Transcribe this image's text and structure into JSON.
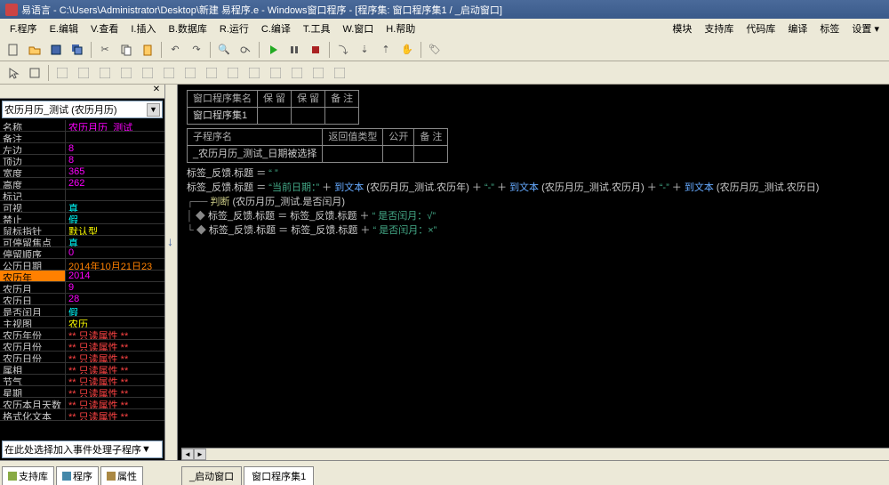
{
  "title": "易语言 - C:\\Users\\Administrator\\Desktop\\新建 易程序.e - Windows窗口程序 - [程序集: 窗口程序集1 / _启动窗口]",
  "menu": {
    "m1": "F.程序",
    "m2": "E.编辑",
    "m3": "V.查看",
    "m4": "I.插入",
    "m5": "B.数据库",
    "m6": "R.运行",
    "m7": "C.编译",
    "m8": "T.工具",
    "m9": "W.窗口",
    "m10": "H.帮助",
    "r1": "模块",
    "r2": "支持库",
    "r3": "代码库",
    "r4": "编译",
    "r5": "标签",
    "r6": "设置 ▾"
  },
  "combo_top": "农历月历_测试 (农历月历)",
  "props": [
    {
      "n": "名称",
      "v": "农历月历_测试",
      "c": "v-magenta"
    },
    {
      "n": "备注",
      "v": "",
      "c": ""
    },
    {
      "n": "左边",
      "v": "8",
      "c": "v-magenta"
    },
    {
      "n": "顶边",
      "v": "8",
      "c": "v-magenta"
    },
    {
      "n": "宽度",
      "v": "365",
      "c": "v-magenta"
    },
    {
      "n": "高度",
      "v": "262",
      "c": "v-magenta"
    },
    {
      "n": "标记",
      "v": "",
      "c": ""
    },
    {
      "n": "可视",
      "v": "真",
      "c": "v-cyan"
    },
    {
      "n": "禁止",
      "v": "假",
      "c": "v-cyan"
    },
    {
      "n": "鼠标指针",
      "v": "默认型",
      "c": "v-yellow"
    },
    {
      "n": "可停留焦点",
      "v": "真",
      "c": "v-cyan"
    },
    {
      "n": "  停留顺序",
      "v": "0",
      "c": "v-magenta"
    },
    {
      "n": "公历日期",
      "v": "2014年10月21日23",
      "c": "v-orange"
    },
    {
      "n": "农历年",
      "v": "2014",
      "c": "v-magenta",
      "sel": true
    },
    {
      "n": "农历月",
      "v": "9",
      "c": "v-magenta"
    },
    {
      "n": "农历日",
      "v": "28",
      "c": "v-magenta"
    },
    {
      "n": "是否闰月",
      "v": "假",
      "c": "v-cyan"
    },
    {
      "n": "主视图",
      "v": "农历",
      "c": "v-yellow"
    },
    {
      "n": "农历年份",
      "v": "** 只读属性 **",
      "c": "v-red"
    },
    {
      "n": "农历月份",
      "v": "** 只读属性 **",
      "c": "v-red"
    },
    {
      "n": "农历日份",
      "v": "** 只读属性 **",
      "c": "v-red"
    },
    {
      "n": "属相",
      "v": "** 只读属性 **",
      "c": "v-red"
    },
    {
      "n": "节气",
      "v": "** 只读属性 **",
      "c": "v-red"
    },
    {
      "n": "星期",
      "v": "** 只读属性 **",
      "c": "v-red"
    },
    {
      "n": "农历本月天数",
      "v": "** 只读属性 **",
      "c": "v-red"
    },
    {
      "n": "格式化文本",
      "v": "** 只读属性 **",
      "c": "v-red"
    }
  ],
  "event_combo": "在此处选择加入事件处理子程序",
  "bottom_tabs": {
    "t1": "支持库",
    "t2": "程序",
    "t3": "属性"
  },
  "editor_tabs": {
    "e1": "_启动窗口",
    "e2": "窗口程序集1"
  },
  "grid1": {
    "h1": "窗口程序集名",
    "h2": "保 留",
    "h3": "保 留",
    "h4": "备 注",
    "r1": "窗口程序集1"
  },
  "grid2": {
    "h1": "子程序名",
    "h2": "返回值类型",
    "h3": "公开",
    "h4": "备 注",
    "r1": "_农历月历_测试_日期被选择"
  },
  "code": {
    "l1a": "标签_反馈.标题 ＝ ",
    "l1b": "“ ”",
    "l2a": "标签_反馈.标题 ＝ ",
    "l2b": "“当前日期：”",
    "l2c": " ＋ ",
    "l2d": "到文本",
    "l2e": " (农历月历_测试.农历年) ",
    "l2f": "＋ ",
    "l2g": "“-”",
    "l2h": " ＋ ",
    "l2i": "到文本",
    "l2j": " (农历月历_测试.农历月) ",
    "l2k": "＋ ",
    "l2l": "“-”",
    "l2m": " ＋ ",
    "l2n": "到文本",
    "l2o": " (农历月历_测试.农历日)",
    "l3a": "判断",
    "l3b": " (农历月历_测试.是否闰月)",
    "l4a": "标签_反馈.标题 ＝ 标签_反馈.标题 ＋ ",
    "l4b": "“  是否闰月：√”",
    "l5a": "标签_反馈.标题 ＝ 标签_反馈.标题 ＋ ",
    "l5b": "“  是否闰月：×”"
  }
}
